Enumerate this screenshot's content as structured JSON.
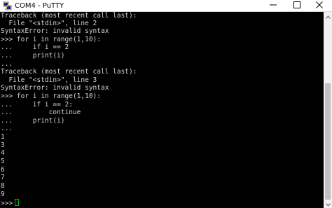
{
  "window": {
    "title": "COM4 - PuTTY",
    "icon": "putty-icon",
    "controls": {
      "minimize_icon": "minimize-icon",
      "maximize_icon": "maximize-icon",
      "close_icon": "close-icon"
    }
  },
  "terminal": {
    "lines": [
      "Traceback (most recent call last):",
      "  File \"<stdin>\", line 2",
      "SyntaxError: invalid syntax",
      ">>> for i in range(1,10):",
      "...     if i == 2",
      "...     print(i)",
      "...",
      "Traceback (most recent call last):",
      "  File \"<stdin>\", line 3",
      "SyntaxError: invalid syntax",
      ">>> for i in range(1,10):",
      "...     if i == 2:",
      "...         continue",
      "...     print(i)",
      "...",
      "1",
      "3",
      "4",
      "5",
      "6",
      "7",
      "8",
      "9"
    ],
    "prompt": ">>>",
    "colors": {
      "background": "#000000",
      "foreground": "#d4d4d4",
      "cursor": "#00c000"
    }
  }
}
